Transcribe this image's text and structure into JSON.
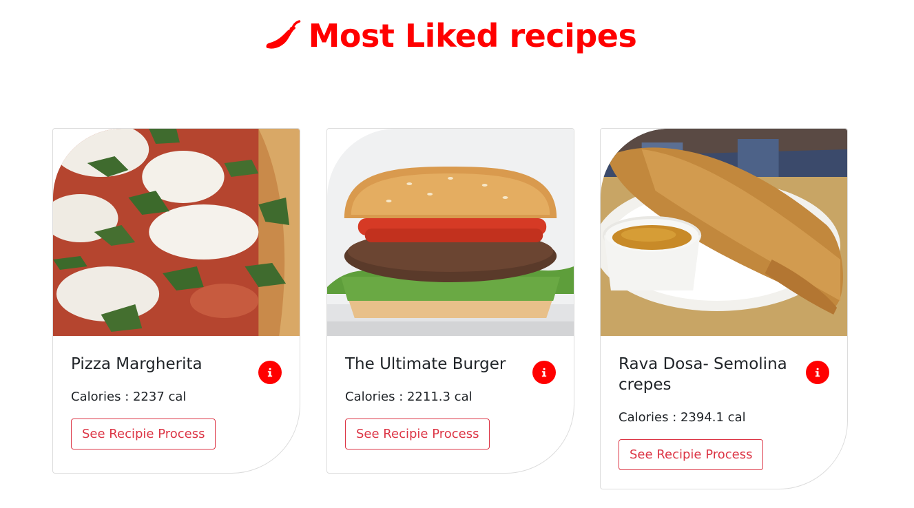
{
  "header": {
    "title": "Most Liked recipes",
    "icon": "chili-pepper-icon",
    "color": "#ff0000"
  },
  "recipes": [
    {
      "title": "Pizza Margherita",
      "calories": "Calories : 2237 cal",
      "button_label": "See Recipie Process",
      "image": "pizza-margherita-photo"
    },
    {
      "title": "The Ultimate Burger",
      "calories": "Calories : 2211.3 cal",
      "button_label": "See Recipie Process",
      "image": "burger-photo"
    },
    {
      "title": "Rava Dosa- Semolina crepes",
      "calories": "Calories : 2394.1 cal",
      "button_label": "See Recipie Process",
      "image": "rava-dosa-photo"
    }
  ],
  "colors": {
    "accent": "#ff0000",
    "button_border": "#dc3545",
    "text": "#212529"
  }
}
